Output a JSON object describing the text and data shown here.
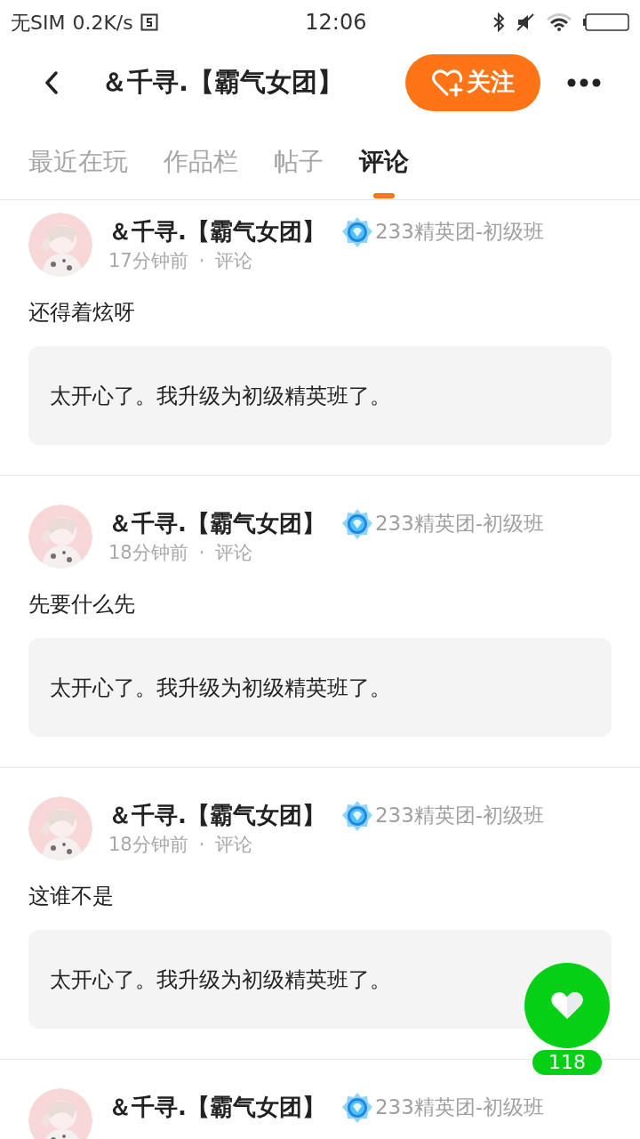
{
  "status_bar": {
    "carrier": "无SIM",
    "speed": "0.2K/s",
    "time": "12:06"
  },
  "header": {
    "title": "＆千寻.【霸气女团】",
    "follow_label": "关注"
  },
  "tabs": [
    {
      "label": "最近在玩",
      "selected": false
    },
    {
      "label": "作品栏",
      "selected": false
    },
    {
      "label": "帖子",
      "selected": false
    },
    {
      "label": "评论",
      "selected": true
    }
  ],
  "comments": [
    {
      "author": "＆千寻.【霸气女团】",
      "badge": "233精英团-初级班",
      "time": "17分钟前",
      "type": "评论",
      "text": "还得着炫呀",
      "quote": "太开心了。我升级为初级精英班了。"
    },
    {
      "author": "＆千寻.【霸气女团】",
      "badge": "233精英团-初级班",
      "time": "18分钟前",
      "type": "评论",
      "text": "先要什么先",
      "quote": "太开心了。我升级为初级精英班了。"
    },
    {
      "author": "＆千寻.【霸气女团】",
      "badge": "233精英团-初级班",
      "time": "18分钟前",
      "type": "评论",
      "text": "这谁不是",
      "quote": "太开心了。我升级为初级精英班了。"
    },
    {
      "author": "＆千寻.【霸气女团】",
      "badge": "233精英团-初级班"
    }
  ],
  "separator": "·",
  "like_button": {
    "count": "118"
  }
}
